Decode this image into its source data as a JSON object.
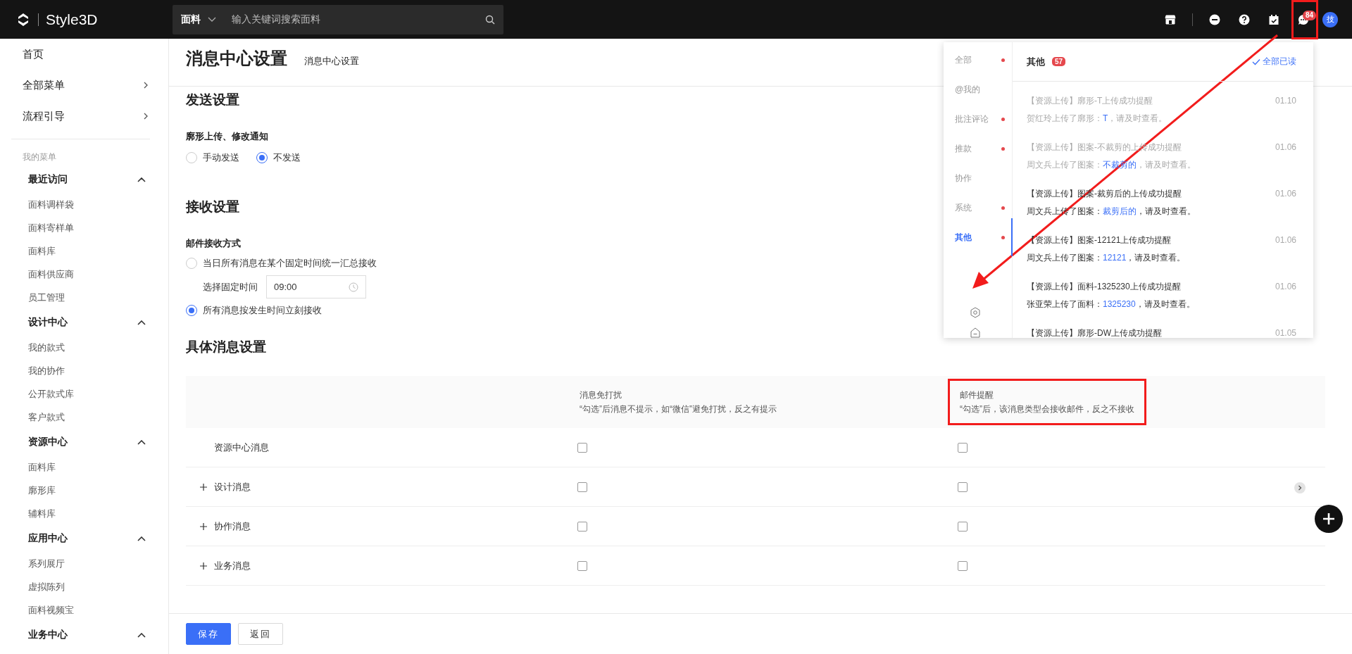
{
  "header": {
    "logo": "Style3D",
    "search": {
      "category": "面料",
      "placeholder": "输入关键词搜索面料"
    },
    "notification_badge": "84",
    "avatar": "技",
    "highlight_messages": true
  },
  "sidebar": {
    "items": [
      {
        "label": "首页",
        "kind": "link"
      },
      {
        "label": "全部菜单",
        "kind": "submenu"
      },
      {
        "label": "流程引导",
        "kind": "submenu"
      }
    ],
    "section_label": "我的菜单",
    "groups": [
      {
        "title": "最近访问",
        "expanded": true,
        "items": [
          "面料调样袋",
          "面料寄样单",
          "面料库",
          "面料供应商",
          "员工管理"
        ]
      },
      {
        "title": "设计中心",
        "expanded": true,
        "items": [
          "我的款式",
          "我的协作",
          "公开款式库",
          "客户款式"
        ]
      },
      {
        "title": "资源中心",
        "expanded": true,
        "items": [
          "面料库",
          "廓形库",
          "辅料库"
        ]
      },
      {
        "title": "应用中心",
        "expanded": true,
        "items": [
          "系列展厅",
          "虚拟陈列",
          "面料视频宝"
        ]
      },
      {
        "title": "业务中心",
        "expanded": true
      }
    ]
  },
  "page": {
    "title": "消息中心设置",
    "breadcrumb": "消息中心设置"
  },
  "send": {
    "heading": "发送设置",
    "field_label": "廓形上传、修改通知",
    "options": [
      {
        "label": "手动发送",
        "selected": false
      },
      {
        "label": "不发送",
        "selected": true
      }
    ]
  },
  "receive": {
    "heading": "接收设置",
    "field_label": "邮件接收方式",
    "options": [
      {
        "label": "当日所有消息在某个固定时间统一汇总接收",
        "selected": false,
        "time_label": "选择固定时间",
        "time_value": "09:00"
      },
      {
        "label": "所有消息按发生时间立刻接收",
        "selected": true
      }
    ]
  },
  "table": {
    "heading": "具体消息设置",
    "columns": [
      {
        "title": "消息免打扰",
        "hint": "“勾选”后消息不提示，如“微信”避免打扰，反之有提示",
        "highlighted": false
      },
      {
        "title": "邮件提醒",
        "hint": "“勾选”后，该消息类型会接收邮件，反之不接收",
        "highlighted": true
      }
    ],
    "rows": [
      {
        "name": "资源中心消息",
        "expandable": false,
        "mute": false,
        "email": false
      },
      {
        "name": "设计消息",
        "expandable": true,
        "mute": false,
        "email": false
      },
      {
        "name": "协作消息",
        "expandable": true,
        "mute": false,
        "email": false
      },
      {
        "name": "业务消息",
        "expandable": true,
        "mute": false,
        "email": false
      }
    ]
  },
  "footer": {
    "buttons": [
      {
        "label": "保存",
        "kind": "primary"
      },
      {
        "label": "返回",
        "kind": "default"
      }
    ]
  },
  "notifications": {
    "tabs": [
      {
        "label": "全部",
        "unread": true,
        "selected": false
      },
      {
        "label": "@我的",
        "unread": false,
        "selected": false
      },
      {
        "label": "批注评论",
        "unread": true,
        "selected": false
      },
      {
        "label": "推款",
        "unread": true,
        "selected": false
      },
      {
        "label": "协作",
        "unread": false,
        "selected": false
      },
      {
        "label": "系统",
        "unread": true,
        "selected": false
      },
      {
        "label": "其他",
        "unread": true,
        "selected": true
      }
    ],
    "title": "其他",
    "count": "57",
    "mark_all": "全部已读",
    "annotation_arrow": true,
    "messages": [
      {
        "title": "【资源上传】廓形-T上传成功提醒",
        "date": "01.10",
        "read": true,
        "body": "贺红玲上传了廓形：",
        "link": "T",
        "after": "，请及时查看。"
      },
      {
        "title": "【资源上传】图案-不裁剪的上传成功提醒",
        "date": "01.06",
        "read": true,
        "body": "周文兵上传了图案：",
        "link": "不裁剪的",
        "after": "，请及时查看。"
      },
      {
        "title": "【资源上传】图案-裁剪后的上传成功提醒",
        "date": "01.06",
        "read": false,
        "body": "周文兵上传了图案：",
        "link": "裁剪后的",
        "after": "，请及时查看。"
      },
      {
        "title": "【资源上传】图案-12121上传成功提醒",
        "date": "01.06",
        "read": false,
        "body": "周文兵上传了图案：",
        "link": "12121",
        "after": "，请及时查看。"
      },
      {
        "title": "【资源上传】面料-1325230上传成功提醒",
        "date": "01.06",
        "read": false,
        "body": "张亚荣上传了面料：",
        "link": "1325230",
        "after": "，请及时查看。"
      },
      {
        "title": "【资源上传】廓形-DW上传成功提醒",
        "date": "01.05",
        "read": false
      }
    ]
  }
}
